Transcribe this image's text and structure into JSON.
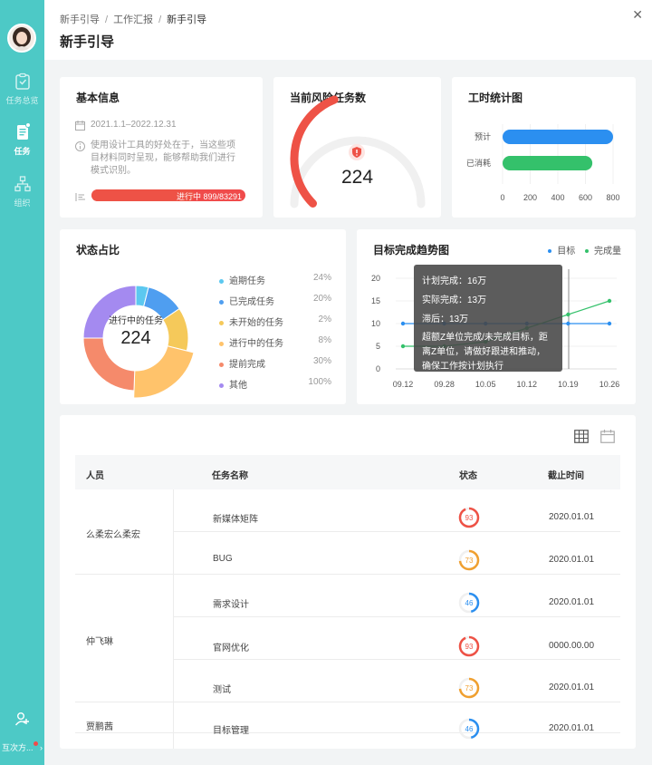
{
  "sidebar": {
    "items": [
      {
        "label": "任务总览"
      },
      {
        "label": "任务"
      },
      {
        "label": "组织"
      }
    ],
    "bottom_label": "互次方..."
  },
  "header": {
    "breadcrumb": [
      "新手引导",
      "工作汇报",
      "新手引导"
    ],
    "title": "新手引导"
  },
  "basic_info": {
    "title": "基本信息",
    "date_range": "2021.1.1–2022.12.31",
    "description_line1": "使用设计工具的好处在于，当这些项",
    "description_line2": "目材料同时呈现，能够帮助我们进行",
    "description_line3": "模式识别。",
    "progress_label": "进行中 899/83291",
    "progress": 0.67
  },
  "risk": {
    "title": "当前风险任务数",
    "value": "224",
    "gauge_fraction": 0.42,
    "color": "#ee5246"
  },
  "hours": {
    "title": "工时统计图",
    "chart_data": {
      "type": "bar",
      "categories": [
        "预计",
        "已消耗"
      ],
      "values": [
        800,
        650
      ],
      "colors": [
        "#2b8ff0",
        "#34c16b"
      ],
      "xlim": [
        0,
        800
      ],
      "xticks": [
        "0",
        "200",
        "400",
        "600",
        "800"
      ]
    }
  },
  "status": {
    "title": "状态占比",
    "center_label": "进行中的任务",
    "center_value": "224",
    "legend": [
      {
        "label": "逾期任务",
        "value": "24%",
        "color": "#5cc8f0"
      },
      {
        "label": "已完成任务",
        "value": "20%",
        "color": "#4f9ef0"
      },
      {
        "label": "未开始的任务",
        "value": "2%",
        "color": "#f5c95a"
      },
      {
        "label": "进行中的任务",
        "value": "8%",
        "color": "#ffc36b"
      },
      {
        "label": "提前完成",
        "value": "30%",
        "color": "#f58a6b"
      },
      {
        "label": "其他",
        "value": "100%",
        "color": "#a48af0"
      }
    ]
  },
  "trend": {
    "title": "目标完成趋势图",
    "legend": [
      {
        "label": "目标",
        "color": "#2b8ff0"
      },
      {
        "label": "完成量",
        "color": "#34c16b"
      }
    ],
    "tooltip": {
      "plan": "计划完成：16万",
      "actual": "实际完成：13万",
      "lag": "滞后：13万",
      "note_line1": "超额Z单位完成/未完成目标，距",
      "note_line2": "离Z单位，请做好跟进和推动，",
      "note_line3": "确保工作按计划执行"
    },
    "chart_data": {
      "type": "line",
      "categories": [
        "09.12",
        "09.28",
        "10.05",
        "10.12",
        "10.19",
        "10.26"
      ],
      "ylim": [
        0,
        20
      ],
      "yticks": [
        "0",
        "5",
        "10",
        "15",
        "20"
      ],
      "series": [
        {
          "name": "目标",
          "values": [
            10,
            10,
            10,
            10,
            10,
            10
          ],
          "color": "#2b8ff0"
        },
        {
          "name": "完成量",
          "values": [
            5,
            5,
            6,
            9,
            12,
            15
          ],
          "color": "#34c16b"
        }
      ]
    }
  },
  "table": {
    "headers": {
      "person": "人员",
      "task": "任务名称",
      "status": "状态",
      "deadline": "截止时间"
    },
    "groups": [
      {
        "person": "么柔宏么柔宏"
      },
      {
        "person": "仲飞琳"
      },
      {
        "person": "贾鹏茜"
      }
    ],
    "rows": [
      {
        "task": "新媒体矩阵",
        "status": "93",
        "color": "#ee5246",
        "deadline": "2020.01.01"
      },
      {
        "task": "BUG",
        "status": "73",
        "color": "#f0a030",
        "deadline": "2020.01.01"
      },
      {
        "task": "需求设计",
        "status": "46",
        "color": "#2b8ff0",
        "deadline": "2020.01.01"
      },
      {
        "task": "官网优化",
        "status": "93",
        "color": "#ee5246",
        "deadline": "0000.00.00"
      },
      {
        "task": "测试",
        "status": "73",
        "color": "#f0a030",
        "deadline": "2020.01.01"
      },
      {
        "task": "目标管理",
        "status": "46",
        "color": "#2b8ff0",
        "deadline": "2020.01.01"
      }
    ]
  }
}
